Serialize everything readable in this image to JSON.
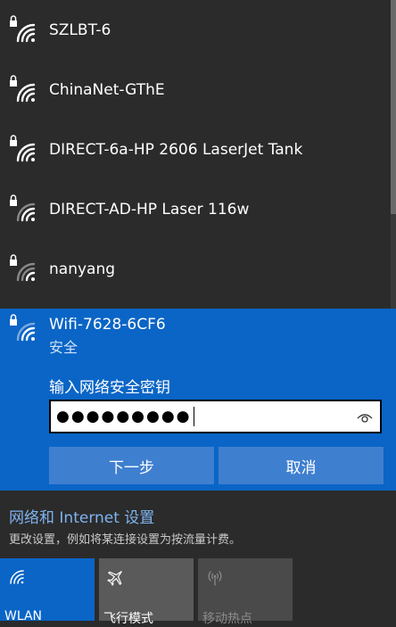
{
  "networks": [
    {
      "name": "SZLBT-6",
      "icon": "wifi-secured-icon"
    },
    {
      "name": "ChinaNet-GThE",
      "icon": "wifi-secured-icon"
    },
    {
      "name": "DIRECT-6a-HP 2606 LaserJet Tank",
      "icon": "wifi-secured-icon"
    },
    {
      "name": "DIRECT-AD-HP Laser 116w",
      "icon": "wifi-secured-icon"
    },
    {
      "name": "nanyang",
      "icon": "wifi-secured-icon"
    }
  ],
  "selected_network": {
    "name": "Wifi-7628-6CF6",
    "status": "安全",
    "key_label": "输入网络安全密钥",
    "password_mask": "●●●●●●●●●",
    "next_button": "下一步",
    "cancel_button": "取消"
  },
  "settings": {
    "link": "网络和 Internet 设置",
    "description": "更改设置，例如将某连接设置为按流量计费。"
  },
  "quick_tiles": [
    {
      "label": "WLAN",
      "icon": "wifi-icon",
      "active": true
    },
    {
      "label": "飞行模式",
      "icon": "airplane-icon",
      "active": false
    },
    {
      "label": "移动热点",
      "icon": "hotspot-icon",
      "active": false
    }
  ],
  "colors": {
    "background": "#2b2b2b",
    "accent": "#0a65c6",
    "button": "#3f7fd0",
    "link": "#7fb3f0"
  }
}
